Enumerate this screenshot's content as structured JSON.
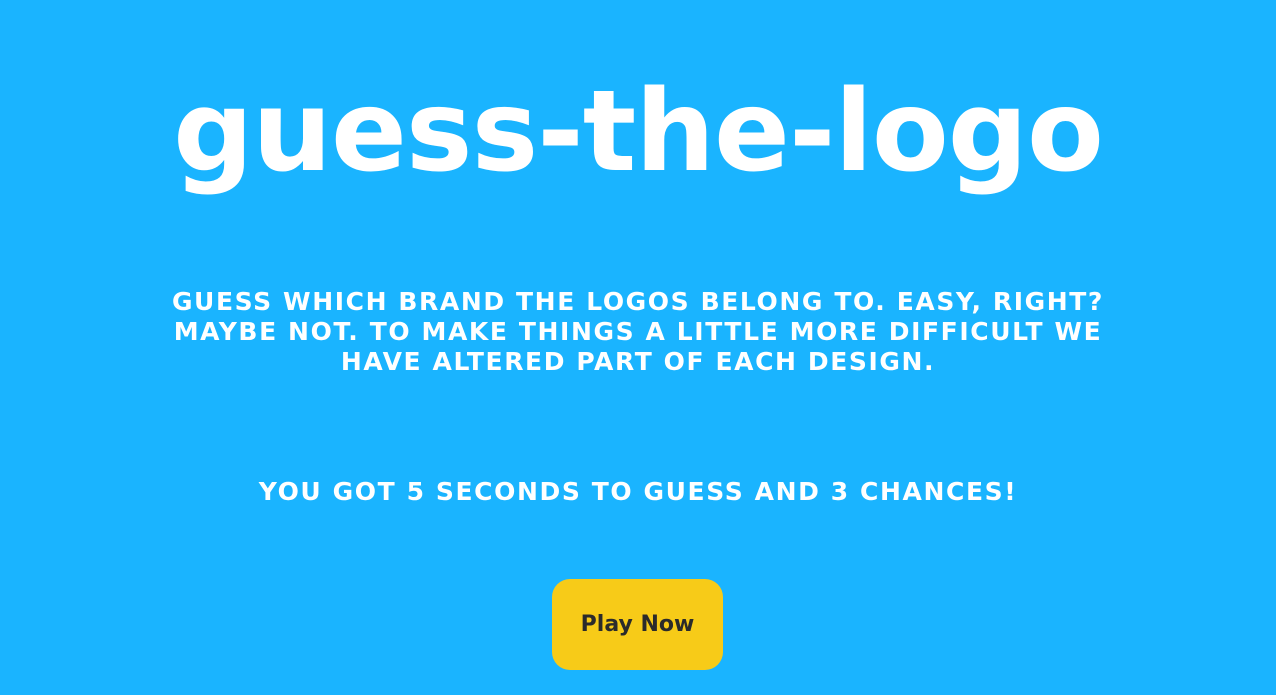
{
  "game": {
    "title": "guess-the-logo",
    "description": "Guess which brand the logos belong to. Easy, right? Maybe not. To make things a little more difficult we have altered part of each design.",
    "rules": "You got 5 seconds to guess and 3 chances!",
    "play_label": "Play Now"
  },
  "colors": {
    "background": "#1ab4ff",
    "text": "#ffffff",
    "button": "#f7cb18",
    "button_text": "#2b2b2b"
  }
}
